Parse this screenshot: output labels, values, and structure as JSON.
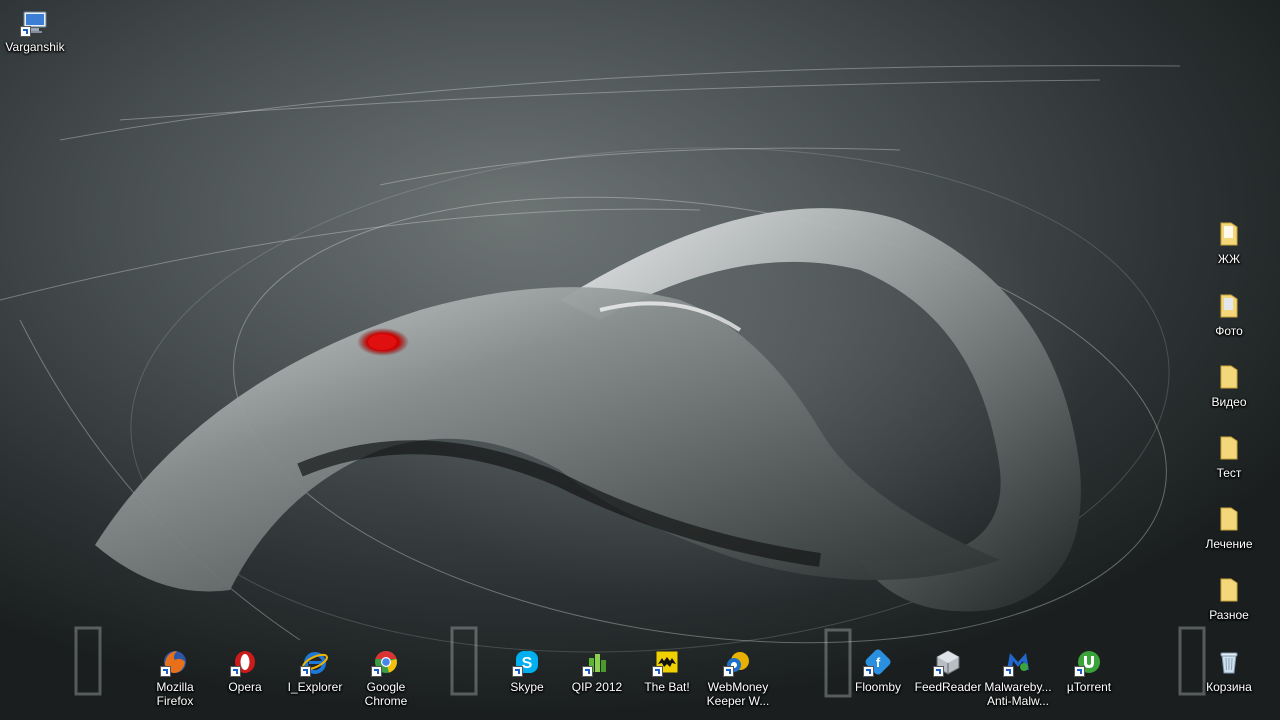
{
  "desktop": {
    "computer": {
      "label": "Varganshik",
      "icon": "computer-icon"
    },
    "folders": [
      {
        "label": "ЖЖ",
        "icon": "folder-icon"
      },
      {
        "label": "Фото",
        "icon": "folder-icon"
      },
      {
        "label": "Видео",
        "icon": "folder-icon"
      },
      {
        "label": "Тест",
        "icon": "folder-icon"
      },
      {
        "label": "Лечение",
        "icon": "folder-icon"
      },
      {
        "label": "Разное",
        "icon": "folder-icon"
      }
    ],
    "recycle_bin": {
      "label": "Корзина",
      "icon": "recycle-bin-icon"
    },
    "shortcuts": [
      {
        "label": "Mozilla\nFirefox",
        "icon": "firefox-icon",
        "color": "#e8701a"
      },
      {
        "label": "Opera",
        "icon": "opera-icon",
        "color": "#cc1b1b"
      },
      {
        "label": "I_Explorer",
        "icon": "internet-explorer-icon",
        "color": "#1e78d7"
      },
      {
        "label": "Google\nChrome",
        "icon": "chrome-icon",
        "color": "#3a9f45"
      },
      {
        "label": "Skype",
        "icon": "skype-icon",
        "color": "#00aff0"
      },
      {
        "label": "QIP 2012",
        "icon": "qip-icon",
        "color": "#5db534"
      },
      {
        "label": "The Bat!",
        "icon": "the-bat-icon",
        "color": "#f0d000"
      },
      {
        "label": "WebMoney\nKeeper W...",
        "icon": "webmoney-icon",
        "color": "#e8b000"
      },
      {
        "label": "Floomby",
        "icon": "floomby-icon",
        "color": "#2b8fe0"
      },
      {
        "label": "FeedReader",
        "icon": "feedreader-icon",
        "color": "#9aa0a6"
      },
      {
        "label": "Malwareby...\nAnti-Malw...",
        "icon": "malwarebytes-icon",
        "color": "#2266cc"
      },
      {
        "label": "µTorrent",
        "icon": "utorrent-icon",
        "color": "#3aa33a"
      }
    ]
  }
}
